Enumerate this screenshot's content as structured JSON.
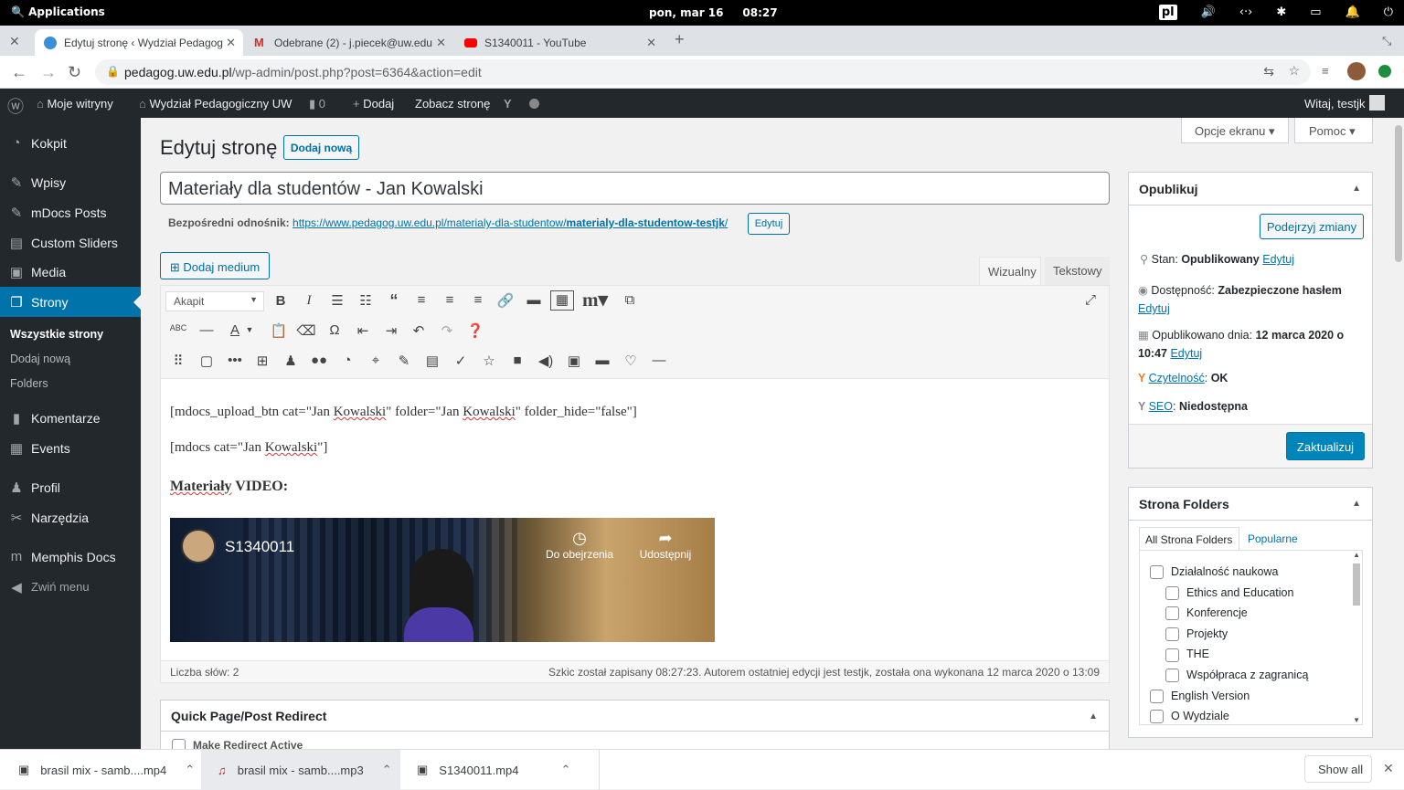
{
  "system": {
    "apps": "Applications",
    "datetime": "pon, mar 16",
    "time": "08:27",
    "keyboard": "pl"
  },
  "tabs": [
    {
      "title": "Edytuj stronę ‹ Wydział Pedagog",
      "favicon": "wordpress-icon"
    },
    {
      "title": "Odebrane (2) - j.piecek@uw.edu",
      "favicon": "gmail-icon"
    },
    {
      "title": "S1340011 - YouTube",
      "favicon": "youtube-icon"
    }
  ],
  "address": {
    "host": "pedagog.uw.edu.pl",
    "path": "/wp-admin/post.php?post=6364&action=edit"
  },
  "adminbar": {
    "sites": "Moje witryny",
    "site_name": "Wydział Pedagogiczny UW",
    "comments": "0",
    "add": "Dodaj",
    "view": "Zobacz stronę",
    "greeting": "Witaj, testjk"
  },
  "sidebar": {
    "items": [
      "Kokpit",
      "Wpisy",
      "mDocs Posts",
      "Custom Sliders",
      "Media",
      "Strony",
      "Komentarze",
      "Events",
      "Profil",
      "Narzędzia",
      "Memphis Docs",
      "Zwiń menu"
    ],
    "sub": [
      "Wszystkie strony",
      "Dodaj nową",
      "Folders"
    ]
  },
  "screen_options": "Opcje ekranu",
  "help": "Pomoc",
  "page": {
    "heading": "Edytuj stronę",
    "add_new": "Dodaj nową",
    "title": "Materiały dla studentów - Jan Kowalski",
    "permalink_label": "Bezpośredni odnośnik:",
    "permalink_base": "https://www.pedagog.uw.edu.pl/materialy-dla-studentow/",
    "permalink_slug": "materialy-dla-studentow-testjk",
    "permalink_end": "/",
    "edit_btn": "Edytuj",
    "add_media": "Dodaj medium",
    "tab_visual": "Wizualny",
    "tab_text": "Tekstowy",
    "format": "Akapit",
    "content": {
      "l1a": "[mdocs_upload_btn cat=\"Jan ",
      "k1": "Kowalski",
      "l1b": "\" folder=\"Jan ",
      "k2": "Kowalski",
      "l1c": "\" folder_hide=\"false\"]",
      "l2a": "[mdocs cat=\"Jan ",
      "k3": "Kowalski",
      "l2b": "\"]",
      "h_a": "Materiały",
      "h_b": " VIDEO:"
    },
    "video": {
      "title": "S1340011",
      "watch_later": "Do obejrzenia",
      "share": "Udostępnij"
    },
    "wordcount": "Liczba słów: 2",
    "draft_status": "Szkic został zapisany 08:27:23. Autorem ostatniej edycji jest testjk, została ona wykonana 12 marca 2020 o 13:09"
  },
  "redirect": {
    "title": "Quick Page/Post Redirect",
    "make_active": "Make Redirect Active"
  },
  "publish": {
    "title": "Opublikuj",
    "preview": "Podejrzyj zmiany",
    "status_label": "Stan:",
    "status_value": "Opublikowany",
    "status_edit": "Edytuj",
    "vis_label": "Dostępność:",
    "vis_value": "Zabezpieczone hasłem",
    "vis_edit": "Edytuj",
    "pub_label": "Opublikowano dnia:",
    "pub_value1": "12 marca 2020 o",
    "pub_value2": "10:47",
    "pub_edit": "Edytuj",
    "read_label": "Czytelność",
    "read_value": "OK",
    "seo_label": "SEO",
    "seo_value": "Niedostępna",
    "update": "Zaktualizuj"
  },
  "folders": {
    "title": "Strona Folders",
    "tab_all": "All Strona Folders",
    "tab_popular": "Popularne",
    "items": [
      {
        "label": "Działalność naukowa",
        "child": false
      },
      {
        "label": "Ethics and Education",
        "child": true
      },
      {
        "label": "Konferencje",
        "child": true
      },
      {
        "label": "Projekty",
        "child": true
      },
      {
        "label": "THE",
        "child": true
      },
      {
        "label": "Współpraca z zagranicą",
        "child": true
      },
      {
        "label": "English Version",
        "child": false
      },
      {
        "label": "O Wydziale",
        "child": false
      }
    ]
  },
  "downloads": {
    "items": [
      "brasil mix - samb....mp4",
      "brasil mix - samb....mp3",
      "S1340011.mp4"
    ],
    "show_all": "Show all"
  }
}
